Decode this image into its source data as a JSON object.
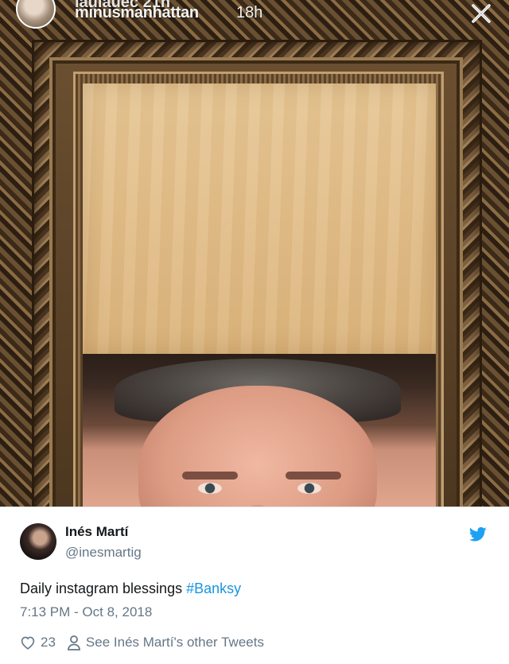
{
  "story": {
    "user_top": "laulauec",
    "user_top_time": "21h",
    "user": "minusmanhattan",
    "time": "18h"
  },
  "tweet": {
    "name": "Inés Martí",
    "handle": "@inesmartig",
    "text": "Daily instagram blessings ",
    "hashtag": "#Banksy",
    "datetime": "7:13 PM - Oct 8, 2018",
    "likes": "23",
    "see_more": "See Inés Martí's other Tweets"
  },
  "colors": {
    "link": "#1b95e0",
    "text": "#14171a",
    "muted": "#657786"
  },
  "icons": [
    "close-icon",
    "twitter-bird-icon",
    "heart-icon",
    "person-icon"
  ]
}
